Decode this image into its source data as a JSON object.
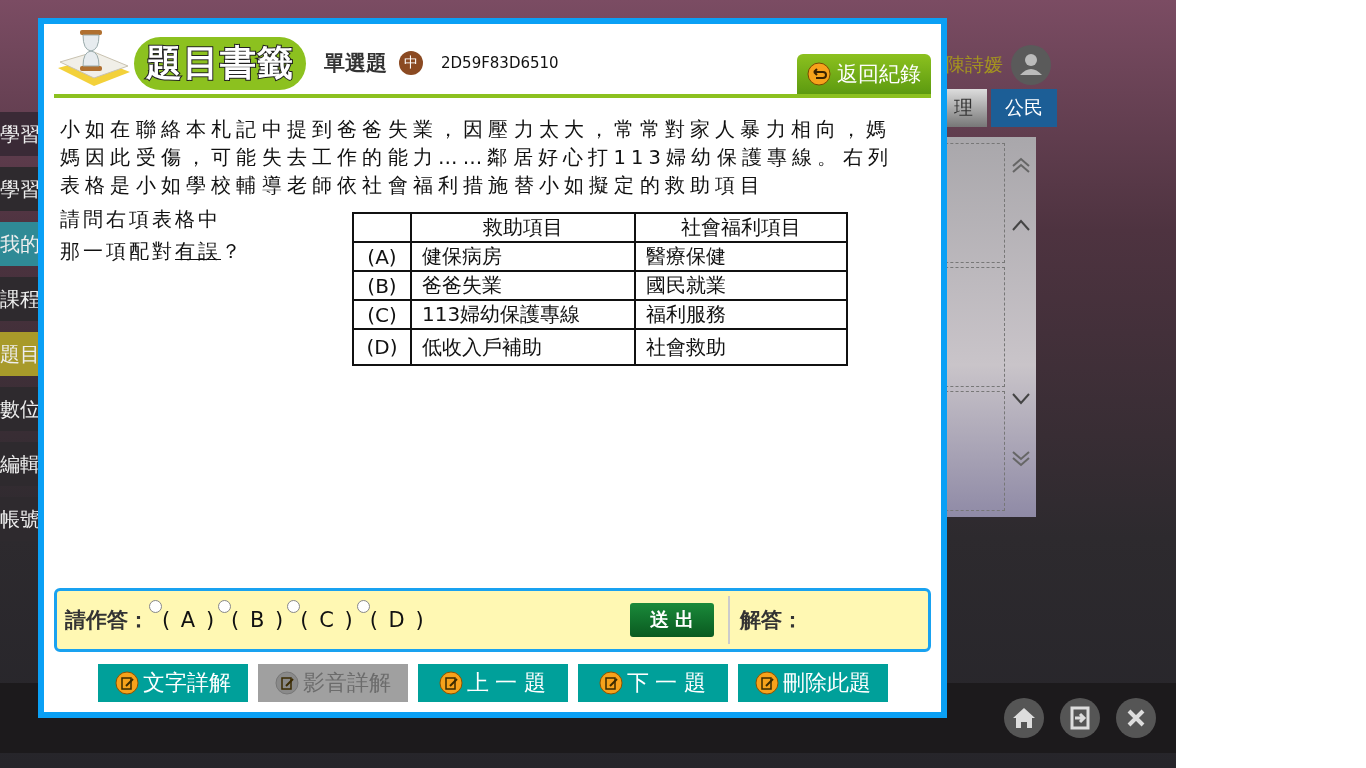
{
  "app": {
    "sidebar": [
      {
        "label": "學習",
        "color": "#3a2a36"
      },
      {
        "label": "學習",
        "color": "#2e2a2e"
      },
      {
        "label": "我的",
        "color": "#2f8a96"
      },
      {
        "label": "課程",
        "color": "#2e2a2e"
      },
      {
        "label": "題目",
        "color": "#a89a2a"
      },
      {
        "label": "數位",
        "color": "#2e2a2e"
      },
      {
        "label": "編輯",
        "color": "#2e2a2e"
      },
      {
        "label": "帳號",
        "color": "#2e2a2e"
      }
    ],
    "user_name": "陳詩媛",
    "subject_tabs": [
      {
        "label": "理",
        "selected": false
      },
      {
        "label": "公民",
        "selected": true
      }
    ]
  },
  "dialog": {
    "title": "題目書籤",
    "question_type": "單選題",
    "difficulty": "中",
    "question_id": "2D59F83D6510",
    "back_button": "返回紀錄",
    "question_text": "小如在聯絡本札記中提到爸爸失業，因壓力太大，常常對家人暴力相向，媽媽因此受傷，可能失去工作的能力……鄰居好心打113婦幼保護專線。右列表格是小如學校輔導老師依社會福利措施替小如擬定的救助項目",
    "prompt_line": "請問右項表格中",
    "prompt_before": "那一項配對",
    "prompt_underlined": "有誤",
    "prompt_after": "？",
    "table": {
      "columns": [
        "救助項目",
        "社會福利項目"
      ],
      "rows": [
        {
          "option": "(A)",
          "aid": "健保病房",
          "welfare": "醫療保健"
        },
        {
          "option": "(B)",
          "aid": "爸爸失業",
          "welfare": "國民就業"
        },
        {
          "option": "(C)",
          "aid": "113婦幼保護專線",
          "welfare": "福利服務"
        },
        {
          "option": "(D)",
          "aid": "低收入戶補助",
          "welfare": "社會救助"
        }
      ]
    },
    "answer": {
      "label": "請作答：",
      "options": [
        {
          "label": "( A )",
          "selected": false
        },
        {
          "label": "( B )",
          "selected": false
        },
        {
          "label": "( C )",
          "selected": false
        },
        {
          "label": "( D )",
          "selected": false
        }
      ],
      "submit": "送 出",
      "solution_label": "解答："
    },
    "actions": [
      {
        "label": "文字詳解",
        "disabled": false
      },
      {
        "label": "影音詳解",
        "disabled": true
      },
      {
        "label": "上 一 題",
        "disabled": false
      },
      {
        "label": "下 一 題",
        "disabled": false
      },
      {
        "label": "刪除此題",
        "disabled": false
      }
    ]
  }
}
